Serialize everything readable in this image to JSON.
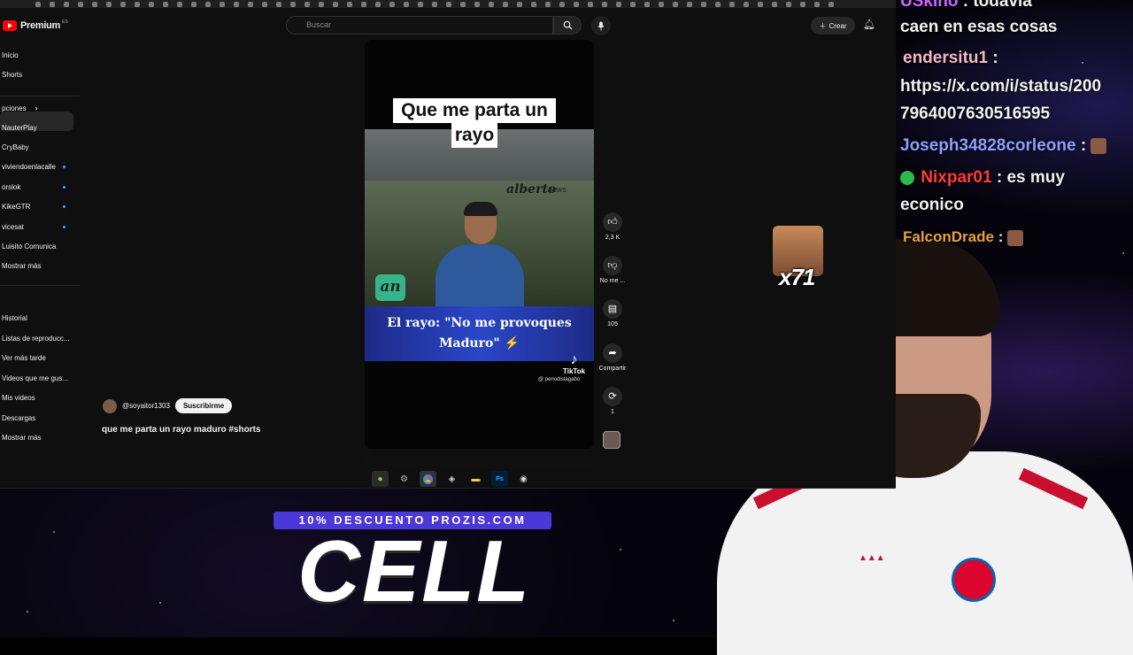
{
  "youtube": {
    "logo_text": "Premium",
    "logo_sup": "ES",
    "search_placeholder": "Buscar",
    "create_label": "Crear"
  },
  "sidebar": {
    "top": [
      {
        "label": "Inicio"
      },
      {
        "label": "Shorts"
      }
    ],
    "subscriptions_header": "pciones",
    "subscriptions": [
      {
        "label": "NauterPlay",
        "new": false
      },
      {
        "label": "CryBaby",
        "new": false
      },
      {
        "label": "viviendoenlacalle",
        "new": true
      },
      {
        "label": "orslok",
        "new": true
      },
      {
        "label": "KikeGTR",
        "new": true
      },
      {
        "label": "vicesat",
        "new": true
      },
      {
        "label": "Luisito Comunica",
        "new": false
      },
      {
        "label": "Mostrar más",
        "new": false
      }
    ],
    "you": [
      {
        "label": "Historial"
      },
      {
        "label": "Listas de reproducc..."
      },
      {
        "label": "Ver más tarde"
      },
      {
        "label": "Videos que me gus..."
      },
      {
        "label": "Mis videos"
      },
      {
        "label": "Descargas"
      },
      {
        "label": "Mostrar más"
      }
    ]
  },
  "short": {
    "title_line1": "Que me parta un",
    "title_line2": "rayo",
    "brand": "alberto",
    "brand2": "news",
    "an_logo": "an",
    "caption": "El rayo: \"No me provoques Maduro\" ⚡",
    "tiktok_label": "TikTok",
    "tiktok_handle": "@ periodistagabo",
    "channel": "@soyaitor1303",
    "subscribe_label": "Suscribirme",
    "description": "que me parta un rayo maduro #shorts"
  },
  "actions": {
    "like_count": "2,3 K",
    "dislike_label": "No me ...",
    "comments_count": "105",
    "share_label": "Compartir",
    "remix_count": "1"
  },
  "chat": {
    "line0_user": "USkino",
    "line0_text": ": todavia",
    "line1_text": "caen en esas cosas",
    "line2_user": "endersitu1",
    "line2_text": ":",
    "line3_text": "https://x.com/i/status/200",
    "line4_text": "7964007630516595",
    "line5_user": "Joseph34828corleone",
    "line5_text": ":",
    "line6_user": "Nixpar01",
    "line6_text": ": es muy",
    "line7_text": "econico",
    "line8_user": "FalconDrade",
    "line8_text": ":",
    "colors": {
      "endersitu1": "#f5b8c8",
      "joseph": "#8aa2ff",
      "nixpar": "#ff3b3b",
      "falcon": "#e8a23a"
    }
  },
  "emote_popup": {
    "count": "x71"
  },
  "promo": {
    "bar_text": "10% DESCUENTO PROZIS.COM",
    "big_text": "CELL"
  }
}
